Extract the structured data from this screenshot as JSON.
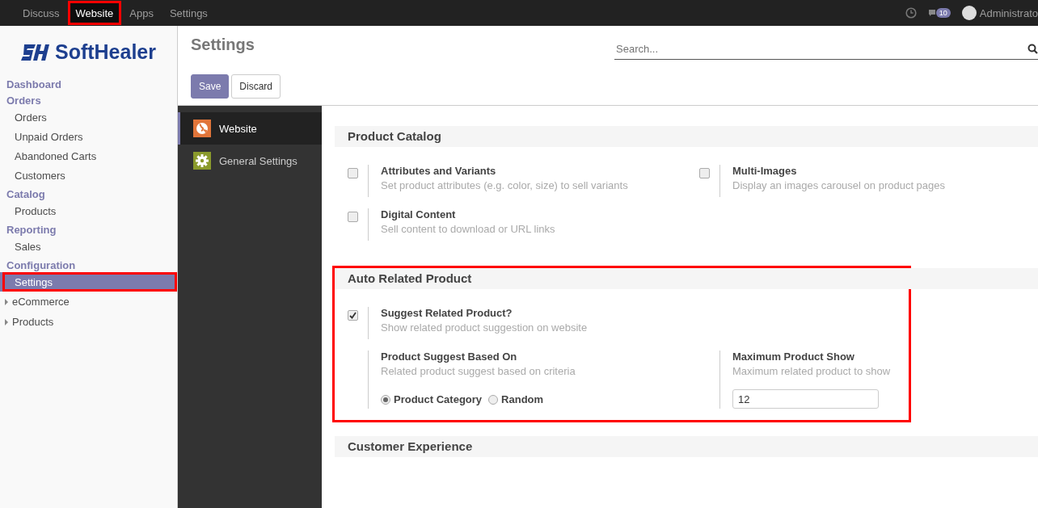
{
  "top_menu": [
    {
      "label": "Discuss",
      "selected": false,
      "highlighted": false
    },
    {
      "label": "Website",
      "selected": true,
      "highlighted": true
    },
    {
      "label": "Apps",
      "selected": false,
      "highlighted": false
    },
    {
      "label": "Settings",
      "selected": false,
      "highlighted": false
    }
  ],
  "systray": {
    "message_count": "10",
    "user": "Administrato"
  },
  "logo": {
    "text": "SoftHealer"
  },
  "sidebar": {
    "groups": [
      {
        "heading": "Dashboard"
      },
      {
        "heading": "Orders",
        "items": [
          {
            "label": "Orders",
            "selected": false,
            "highlighted": false
          },
          {
            "label": "Unpaid Orders",
            "selected": false,
            "highlighted": false
          },
          {
            "label": "Abandoned Carts",
            "selected": false,
            "highlighted": false
          },
          {
            "label": "Customers",
            "selected": false,
            "highlighted": false
          }
        ]
      },
      {
        "heading": "Catalog",
        "items": [
          {
            "label": "Products",
            "selected": false,
            "highlighted": false
          }
        ]
      },
      {
        "heading": "Reporting",
        "items": [
          {
            "label": "Sales",
            "selected": false,
            "highlighted": false
          }
        ]
      },
      {
        "heading": "Configuration",
        "items": [
          {
            "label": "Settings",
            "selected": true,
            "highlighted": true
          }
        ]
      }
    ],
    "folders": [
      {
        "label": "eCommerce",
        "expanded": false
      },
      {
        "label": "Products",
        "expanded": false
      }
    ]
  },
  "page": {
    "title": "Settings",
    "search": {
      "placeholder": "Search..."
    },
    "buttons": [
      {
        "label": "Save",
        "kind": "primary"
      },
      {
        "label": "Discard",
        "kind": "secondary"
      }
    ]
  },
  "apps": [
    {
      "label": "Website",
      "selected": true,
      "kind": "globe"
    },
    {
      "label": "General Settings",
      "selected": false,
      "kind": "gear"
    }
  ],
  "sections": [
    {
      "title": "Product Catalog",
      "highlighted": false,
      "settings": [
        {
          "kind": "checkbox",
          "title": "Attributes and Variants",
          "description": "Set product attributes (e.g. color, size) to sell variants",
          "checked": false
        },
        {
          "kind": "checkbox",
          "title": "Multi-Images",
          "description": "Display an images carousel on product pages",
          "checked": false
        },
        {
          "kind": "checkbox",
          "title": "Digital Content",
          "description": "Sell content to download or URL links",
          "checked": false
        }
      ]
    },
    {
      "title": "Auto Related Product",
      "highlighted": true,
      "settings": [
        {
          "kind": "checkbox",
          "title": "Suggest Related Product?",
          "description": "Show related product suggestion on website",
          "checked": true
        },
        {
          "kind": "spacer"
        },
        {
          "kind": "radio",
          "title": "Product Suggest Based On",
          "description": "Related product suggest based on criteria",
          "options": [
            {
              "label": "Product Category",
              "selected": true
            },
            {
              "label": "Random",
              "selected": false
            }
          ]
        },
        {
          "kind": "number",
          "title": "Maximum Product Show",
          "description": "Maximum related product to show",
          "value": "12"
        }
      ]
    },
    {
      "title": "Customer Experience",
      "highlighted": false
    }
  ]
}
